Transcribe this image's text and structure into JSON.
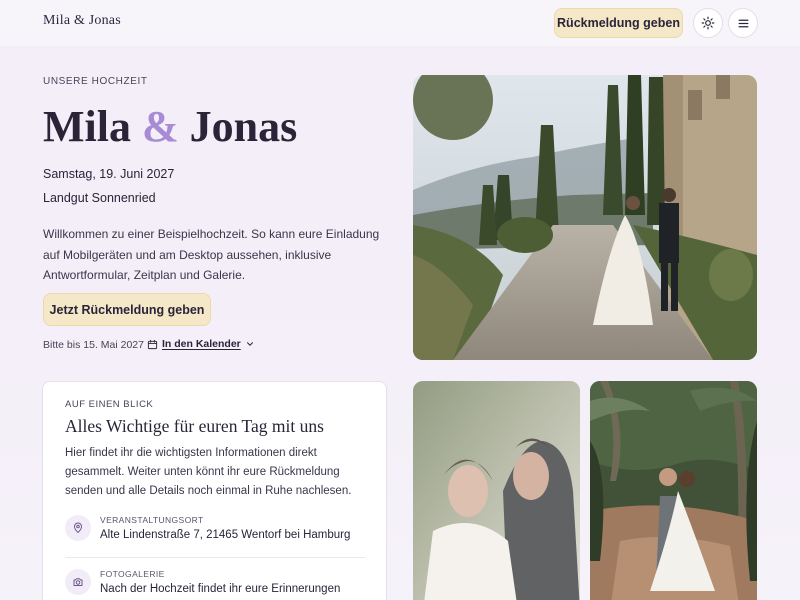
{
  "header": {
    "brand": "Mila & Jonas",
    "feedback_label": "Rückmeldung geben",
    "theme_icon": "sun-icon",
    "menu_icon": "menu-icon"
  },
  "hero": {
    "eyebrow": "UNSERE HOCHZEIT",
    "name_a": "Mila",
    "amp": "&",
    "name_b": "Jonas",
    "date": "Samstag, 19. Juni 2027",
    "venue": "Landgut Sonnenried",
    "intro": "Willkommen zu einer Beispielhochzeit. So kann eure Einladung auf Mobilgeräten und am Desktop aussehen, inklusive Antwortformular, Zeitplan und Galerie.",
    "rsvp_label": "Jetzt Rückmeldung geben",
    "deadline": "Bitte bis 15. Mai 2027",
    "calendar_label": "In den Kalender"
  },
  "card": {
    "eyebrow": "AUF EINEN BLICK",
    "title": "Alles Wichtige für euren Tag mit uns",
    "text": "Hier findet ihr die wichtigsten Informationen direkt gesammelt. Weiter unten könnt ihr eure Rückmeldung senden und alle Details noch einmal in Ruhe nachlesen.",
    "rows": [
      {
        "label": "VERANSTALTUNGSORT",
        "value": "Alte Lindenstraße 7, 21465 Wentorf bei Hamburg",
        "icon": "location-pin-icon"
      },
      {
        "label": "FOTOGALERIE",
        "value": "Nach der Hochzeit findet ihr eure Erinnerungen",
        "icon": "camera-icon"
      }
    ]
  },
  "colors": {
    "accent_gold": "#f5e8c9",
    "accent_lavender": "#a78bd4",
    "background": "#f4eef9",
    "text": "#2a2438"
  }
}
